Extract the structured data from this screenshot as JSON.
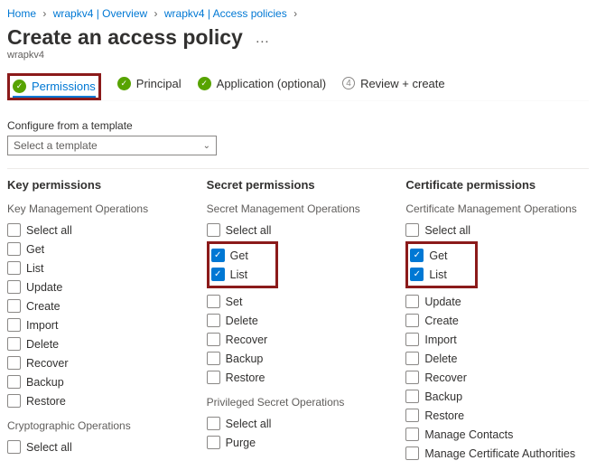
{
  "breadcrumb": {
    "home": "Home",
    "item1": "wrapkv4 | Overview",
    "item2": "wrapkv4 | Access policies"
  },
  "title": "Create an access policy",
  "resource": "wrapkv4",
  "wizard": {
    "step1": "Permissions",
    "step2": "Principal",
    "step3": "Application (optional)",
    "step4": "Review + create",
    "step4_num": "4"
  },
  "template": {
    "label": "Configure from a template",
    "placeholder": "Select a template"
  },
  "key": {
    "heading": "Key permissions",
    "mgmt_label": "Key Management Operations",
    "select_all": "Select all",
    "ops": {
      "get": "Get",
      "list": "List",
      "update": "Update",
      "create": "Create",
      "import": "Import",
      "delete": "Delete",
      "recover": "Recover",
      "backup": "Backup",
      "restore": "Restore"
    },
    "crypto_label": "Cryptographic Operations",
    "crypto_select_all": "Select all"
  },
  "secret": {
    "heading": "Secret permissions",
    "mgmt_label": "Secret Management Operations",
    "select_all": "Select all",
    "ops": {
      "get": "Get",
      "list": "List",
      "set": "Set",
      "delete": "Delete",
      "recover": "Recover",
      "backup": "Backup",
      "restore": "Restore"
    },
    "priv_label": "Privileged Secret Operations",
    "priv_select_all": "Select all",
    "priv_ops": {
      "purge": "Purge"
    }
  },
  "cert": {
    "heading": "Certificate permissions",
    "mgmt_label": "Certificate Management Operations",
    "select_all": "Select all",
    "ops": {
      "get": "Get",
      "list": "List",
      "update": "Update",
      "create": "Create",
      "import": "Import",
      "delete": "Delete",
      "recover": "Recover",
      "backup": "Backup",
      "restore": "Restore",
      "contacts": "Manage Contacts",
      "cas": "Manage Certificate Authorities"
    }
  }
}
